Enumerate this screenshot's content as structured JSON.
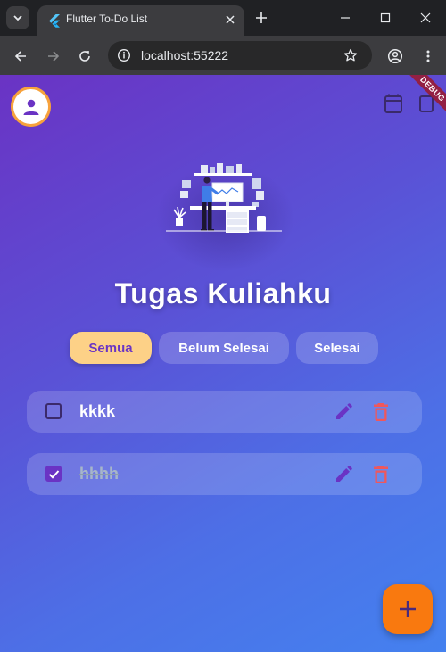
{
  "browser": {
    "tab_title": "Flutter To-Do List",
    "url": "localhost:55222"
  },
  "app": {
    "title": "Tugas Kuliahku",
    "debug_banner": "DEBUG",
    "filters": [
      {
        "label": "Semua",
        "active": true
      },
      {
        "label": "Belum Selesai",
        "active": false
      },
      {
        "label": "Selesai",
        "active": false
      }
    ],
    "tasks": [
      {
        "title": "kkkk",
        "done": false
      },
      {
        "title": "hhhh",
        "done": true
      }
    ],
    "icons": {
      "profile": "person-icon",
      "calendar": "calendar-icon",
      "edit": "pencil-icon",
      "delete": "trash-icon",
      "add": "plus-icon"
    },
    "colors": {
      "accent": "#6a33c4",
      "active_chip": "#fdd187",
      "fab": "#f9790f",
      "delete": "#f0575b",
      "avatar_ring": "#f7a23c"
    }
  }
}
